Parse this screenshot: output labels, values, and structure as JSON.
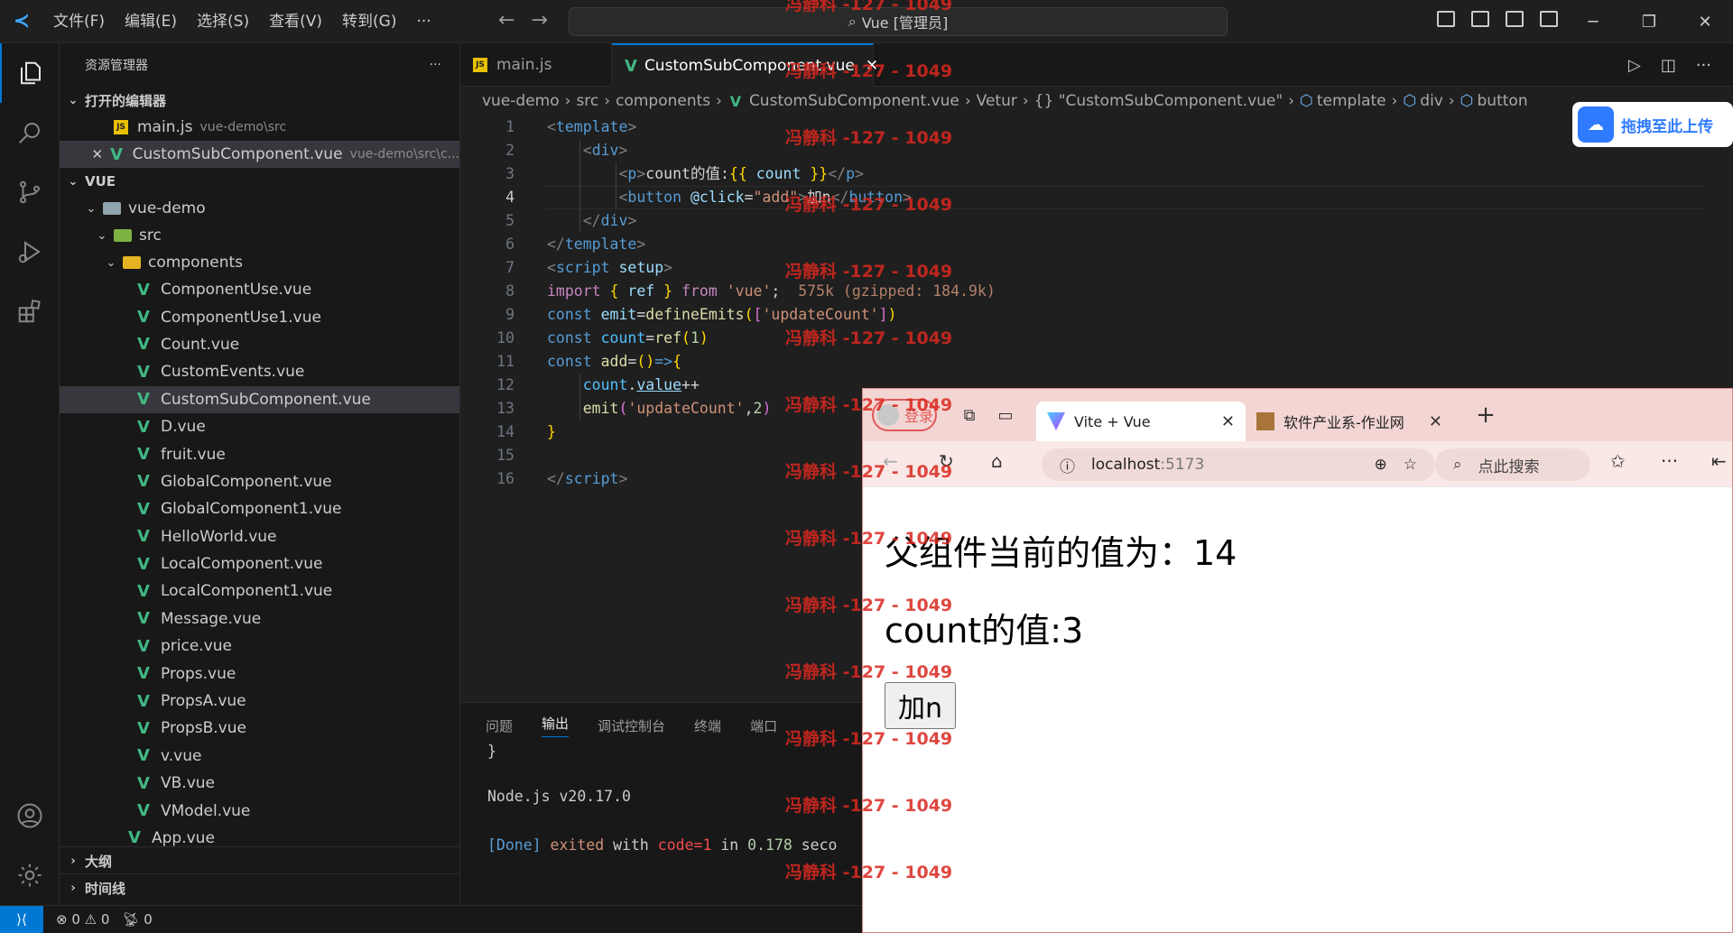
{
  "menu": [
    "文件(F)",
    "编辑(E)",
    "选择(S)",
    "查看(V)",
    "转到(G)",
    "···"
  ],
  "command_center": "Vue [管理员]",
  "explorer": {
    "title": "资源管理器",
    "more": "···",
    "open_editors_label": "打开的编辑器",
    "open_editors": [
      {
        "name": "main.js",
        "path": "vue-demo\\src"
      },
      {
        "name": "CustomSubComponent.vue",
        "path": "vue-demo\\src\\c..."
      }
    ],
    "root_label": "VUE",
    "project": "vue-demo",
    "src": "src",
    "components": "components",
    "files": [
      "ComponentUse.vue",
      "ComponentUse1.vue",
      "Count.vue",
      "CustomEvents.vue",
      "CustomSubComponent.vue",
      "D.vue",
      "fruit.vue",
      "GlobalComponent.vue",
      "GlobalComponent1.vue",
      "HelloWorld.vue",
      "LocalComponent.vue",
      "LocalComponent1.vue",
      "Message.vue",
      "price.vue",
      "Props.vue",
      "PropsA.vue",
      "PropsB.vue",
      "v.vue",
      "VB.vue",
      "VModel.vue"
    ],
    "app": "App.vue",
    "outline_label": "大纲",
    "timeline_label": "时间线"
  },
  "tabs": [
    {
      "label": "main.js",
      "active": false
    },
    {
      "label": "CustomSubComponent.vue",
      "active": true
    }
  ],
  "breadcrumb": [
    "vue-demo",
    "src",
    "components",
    "CustomSubComponent.vue",
    "Vetur",
    "{} \"CustomSubComponent.vue\"",
    "template",
    "div",
    "button"
  ],
  "code": {
    "line_numbers": [
      "1",
      "2",
      "3",
      "4",
      "5",
      "6",
      "7",
      "8",
      "9",
      "10",
      "11",
      "12",
      "13",
      "14",
      "15",
      "16"
    ],
    "current_line": 4,
    "import_size": "575k (gzipped: 184.9k)"
  },
  "panel": {
    "tabs": [
      "问题",
      "输出",
      "调试控制台",
      "终端",
      "端口"
    ],
    "active_tab": "输出",
    "lines": [
      "}",
      "Node.js v20.17.0",
      "[Done] exited with code=1 in 0.178 seco"
    ]
  },
  "status": {
    "errors": "0",
    "warnings": "0",
    "ports": "0"
  },
  "baidu_upload": "拖拽至此上传",
  "browser": {
    "login": "登录",
    "tabs": [
      {
        "label": "Vite + Vue",
        "active": true
      },
      {
        "label": "软件产业系-作业网",
        "active": false
      }
    ],
    "address_host": "localhost",
    "address_port": ":5173",
    "search_placeholder": "点此搜索",
    "content": {
      "parent_heading": "父组件当前的值为：14",
      "count_text": "count的值:3",
      "button_label": "加n"
    }
  },
  "watermark": "冯静科 -127 - 1049",
  "colors": {
    "accent": "#0078d4",
    "vue_green": "#41b883",
    "watermark": "#d9281f"
  }
}
